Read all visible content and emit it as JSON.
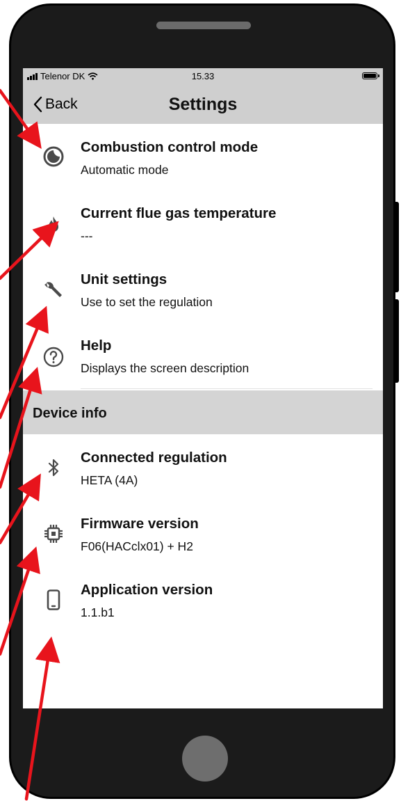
{
  "status_bar": {
    "carrier": "Telenor DK",
    "time": "15.33"
  },
  "nav": {
    "back_label": "Back",
    "title": "Settings"
  },
  "settings_items": [
    {
      "title": "Combustion control mode",
      "subtitle": "Automatic mode",
      "icon": "half-moon-icon"
    },
    {
      "title": "Current flue gas temperature",
      "subtitle": "---",
      "icon": "flame-icon"
    },
    {
      "title": "Unit settings",
      "subtitle": "Use to set the regulation",
      "icon": "wrench-icon"
    },
    {
      "title": "Help",
      "subtitle": "Displays the screen description",
      "icon": "help-icon"
    }
  ],
  "device_info": {
    "header": "Device info",
    "items": [
      {
        "title": "Connected regulation",
        "subtitle": "HETA (4A)",
        "icon": "bluetooth-icon"
      },
      {
        "title": "Firmware version",
        "subtitle": "F06(HACclx01) + H2",
        "icon": "chip-icon"
      },
      {
        "title": "Application version",
        "subtitle": "1.1.b1",
        "icon": "phone-icon"
      }
    ]
  },
  "colors": {
    "bar_gray": "#cfcfcf",
    "icon_gray": "#4a4a4a",
    "annotation_arrow": "#e8141c",
    "phone_body": "#1b1b1b"
  }
}
